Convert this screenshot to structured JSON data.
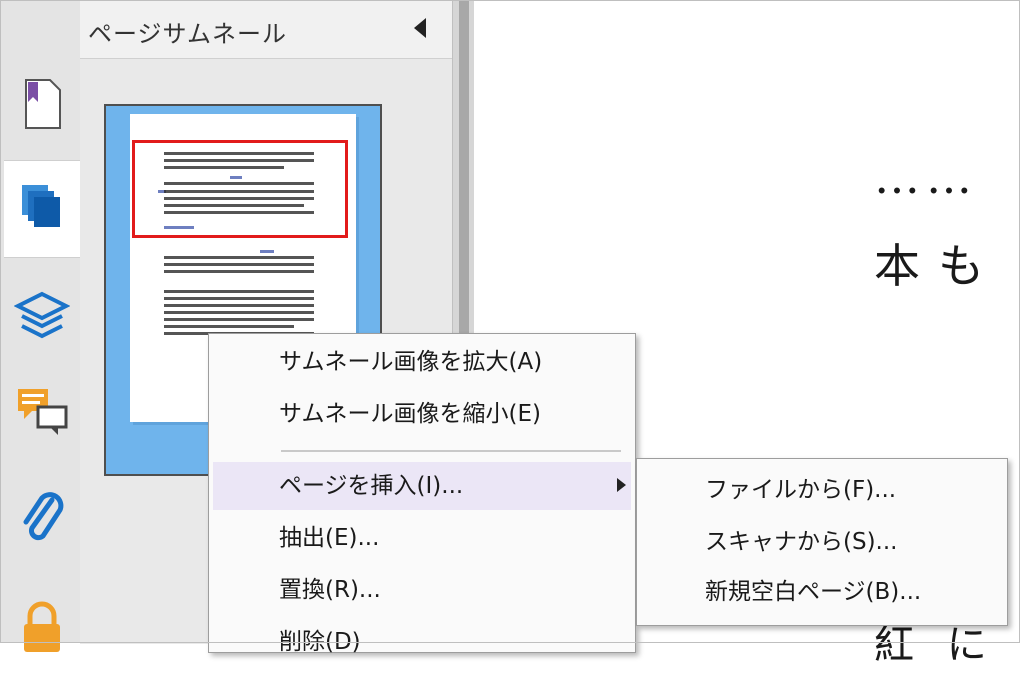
{
  "panel": {
    "title": "ページサムネール",
    "collapse_icon": "triangle-left-icon"
  },
  "rail": {
    "items": [
      {
        "name": "bookmark-icon",
        "active": false
      },
      {
        "name": "page-thumbnails-icon",
        "active": true
      },
      {
        "name": "layers-icon",
        "active": false
      },
      {
        "name": "comments-icon",
        "active": false
      },
      {
        "name": "attachment-icon",
        "active": false
      },
      {
        "name": "lock-icon",
        "active": false
      }
    ]
  },
  "document": {
    "line1": "……",
    "line2": "本も",
    "line3": "紅 に"
  },
  "context_menu": {
    "items": [
      {
        "label": "サムネール画像を拡大(A)"
      },
      {
        "label": "サムネール画像を縮小(E)"
      },
      {
        "label": "ページを挿入(I)...",
        "has_submenu": true,
        "highlighted": true
      },
      {
        "label": "抽出(E)..."
      },
      {
        "label": "置換(R)..."
      },
      {
        "label": "削除(D)"
      }
    ]
  },
  "submenu": {
    "items": [
      {
        "label": "ファイルから(F)..."
      },
      {
        "label": "スキャナから(S)..."
      },
      {
        "label": "新規空白ページ(B)..."
      }
    ]
  },
  "colors": {
    "selection": "#e21b1b",
    "thumb_frame": "#6fb4ec",
    "menu_highlight": "#ebe6f6",
    "icon_purple": "#7b4fa6",
    "icon_blue": "#1a73c9",
    "icon_orange": "#f0a02a"
  }
}
